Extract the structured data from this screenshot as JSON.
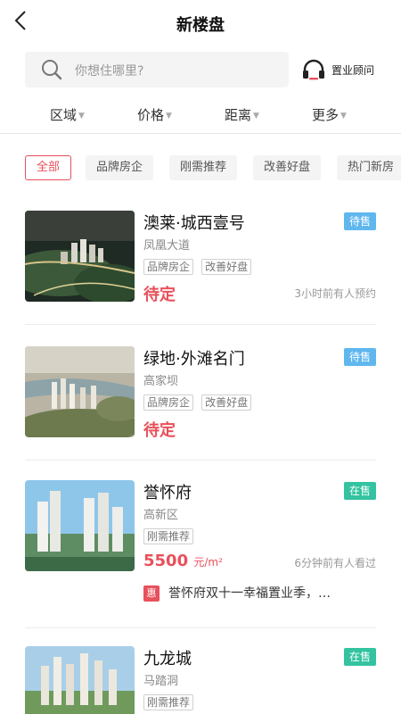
{
  "header": {
    "title": "新楼盘"
  },
  "search": {
    "placeholder": "你想住哪里?"
  },
  "consultant": {
    "label": "置业顾问"
  },
  "filters": [
    {
      "label": "区域"
    },
    {
      "label": "价格"
    },
    {
      "label": "距离"
    },
    {
      "label": "更多"
    }
  ],
  "chips": [
    {
      "label": "全部",
      "active": true
    },
    {
      "label": "品牌房企"
    },
    {
      "label": "刚需推荐"
    },
    {
      "label": "改善好盘"
    },
    {
      "label": "热门新房"
    }
  ],
  "listings": [
    {
      "name": "澳莱·城西壹号",
      "status": "待售",
      "district": "凤凰大道",
      "tags": [
        "品牌房企",
        "改善好盘"
      ],
      "price": "待定",
      "unit": "",
      "note": "3小时前有人预约"
    },
    {
      "name": "绿地·外滩名门",
      "status": "待售",
      "district": "高家坝",
      "tags": [
        "品牌房企",
        "改善好盘"
      ],
      "price": "待定",
      "unit": "",
      "note": ""
    },
    {
      "name": "誉怀府",
      "status": "在售",
      "district": "高新区",
      "tags": [
        "刚需推荐"
      ],
      "price": "5500",
      "unit": "元/m²",
      "note": "6分钟前有人看过",
      "promo_badge": "惠",
      "promo_text": "誉怀府双十一幸福置业季，…"
    },
    {
      "name": "九龙城",
      "status": "在售",
      "district": "马踏洞",
      "tags": [
        "刚需推荐"
      ],
      "price": "",
      "unit": "",
      "note": ""
    }
  ],
  "colors": {
    "accent": "#e8505b",
    "status_pending": "#5fb7ee",
    "status_onsale": "#34c3a0"
  },
  "icons": {
    "back": "chevron-left-icon",
    "search": "search-icon",
    "consultant": "headset-icon",
    "filter_caret": "caret-down-icon",
    "promo": "discount-badge-icon"
  }
}
